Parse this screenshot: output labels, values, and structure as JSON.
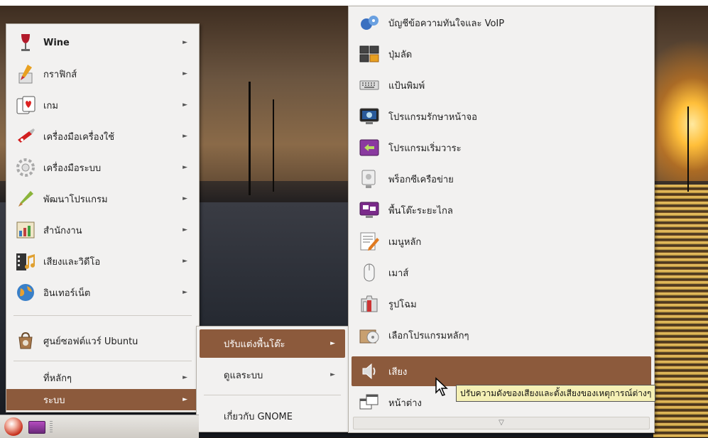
{
  "main_menu": {
    "items": [
      {
        "label": "Wine",
        "icon": "wine-glass-icon"
      },
      {
        "label": "กราฟิกส์",
        "icon": "graphics-icon"
      },
      {
        "label": "เกม",
        "icon": "games-icon"
      },
      {
        "label": "เครื่องมือเครื่องใช้",
        "icon": "accessories-icon"
      },
      {
        "label": "เครื่องมือระบบ",
        "icon": "system-tools-icon"
      },
      {
        "label": "พัฒนาโปรแกรม",
        "icon": "programming-icon"
      },
      {
        "label": "สำนักงาน",
        "icon": "office-icon"
      },
      {
        "label": "เสียงและวิดีโอ",
        "icon": "sound-video-icon"
      },
      {
        "label": "อินเทอร์เน็ต",
        "icon": "internet-icon"
      }
    ],
    "software_center": "ศูนย์ซอฟต์แวร์ Ubuntu",
    "places": "ที่หลักๆ",
    "system": "ระบบ"
  },
  "system_menu": {
    "items": [
      "ปรับแต่งพื้นโต๊ะ",
      "ดูแลระบบ",
      "เกี่ยวกับ GNOME"
    ]
  },
  "preferences_menu": {
    "items": [
      {
        "label": "บัญชีข้อความทันใจและ VoIP",
        "icon": "im-accounts-icon"
      },
      {
        "label": "ปุ่มลัด",
        "icon": "keyboard-shortcuts-icon"
      },
      {
        "label": "แป้นพิมพ์",
        "icon": "keyboard-icon"
      },
      {
        "label": "โปรแกรมรักษาหน้าจอ",
        "icon": "screensaver-icon"
      },
      {
        "label": "โปรแกรมเริ่มวาระ",
        "icon": "startup-apps-icon"
      },
      {
        "label": "พร็อกซีเครือข่าย",
        "icon": "network-proxy-icon"
      },
      {
        "label": "พื้นโต๊ะระยะไกล",
        "icon": "remote-desktop-icon"
      },
      {
        "label": "เมนูหลัก",
        "icon": "main-menu-icon"
      },
      {
        "label": "เมาส์",
        "icon": "mouse-icon"
      },
      {
        "label": "รูปโฉม",
        "icon": "appearance-icon"
      },
      {
        "label": "เลือกโปรแกรมหลักๆ",
        "icon": "preferred-apps-icon"
      },
      {
        "label": "เสียง",
        "icon": "sound-icon"
      },
      {
        "label": "หน้าต่าง",
        "icon": "windows-icon"
      }
    ],
    "scroll_glyph": "▽"
  },
  "tooltip": "ปรับความดังของเสียงและตั้งเสียงของเหตุการณ์ต่างๆ",
  "arrow_glyph": "►",
  "colors": {
    "highlight": "#8c5a3c",
    "tooltip_bg": "#f5f0b5",
    "menu_bg": "#f2f1f0"
  }
}
